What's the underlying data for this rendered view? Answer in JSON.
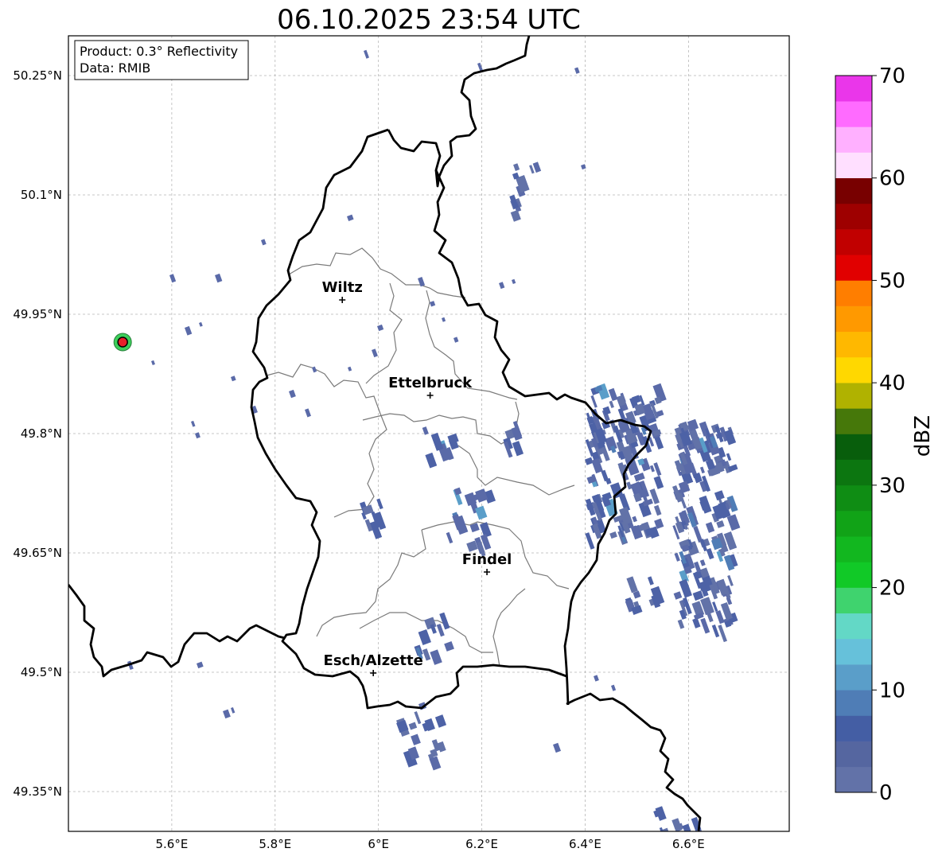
{
  "title": "06.10.2025 23:54 UTC",
  "info_box": {
    "product": "Product: 0.3° Reflectivity",
    "data": "Data: RMIB"
  },
  "axes": {
    "lon_ticks": [
      "5.6°E",
      "5.8°E",
      "6°E",
      "6.2°E",
      "6.4°E",
      "6.6°E"
    ],
    "lat_ticks": [
      "50.25°N",
      "50.1°N",
      "49.95°N",
      "49.8°N",
      "49.65°N",
      "49.5°N",
      "49.35°N"
    ],
    "lon_range": [
      5.4,
      6.795
    ],
    "lat_range": [
      49.3,
      50.3
    ]
  },
  "cities": [
    {
      "name": "Wiltz",
      "lon": 5.93,
      "lat": 49.968
    },
    {
      "name": "Ettelbruck",
      "lon": 6.1,
      "lat": 49.848
    },
    {
      "name": "Findel",
      "lon": 6.21,
      "lat": 49.626
    },
    {
      "name": "Esch/Alzette",
      "lon": 5.99,
      "lat": 49.499
    }
  ],
  "radar_site": {
    "lon": 5.505,
    "lat": 49.915,
    "color": "#e8202a"
  },
  "colorbar": {
    "label": "dBZ",
    "ticks": [
      "0",
      "10",
      "20",
      "30",
      "40",
      "50",
      "60",
      "70"
    ],
    "min": 0,
    "max": 70,
    "step": 2.5,
    "colors": [
      "#6272a8",
      "#5566a0",
      "#445ea4",
      "#4f7db6",
      "#5a9ec9",
      "#66c1da",
      "#63d8c6",
      "#3fd36e",
      "#11c927",
      "#12b71f",
      "#11a317",
      "#0f8d14",
      "#0c7610",
      "#085e0c",
      "#46780a",
      "#b0b200",
      "#ffd800",
      "#ffb800",
      "#ff9900",
      "#ff7e00",
      "#e10000",
      "#c10000",
      "#9e0000",
      "#780000",
      "#ffdfff",
      "#ffb0ff",
      "#ff6bff",
      "#ea36ea"
    ]
  }
}
